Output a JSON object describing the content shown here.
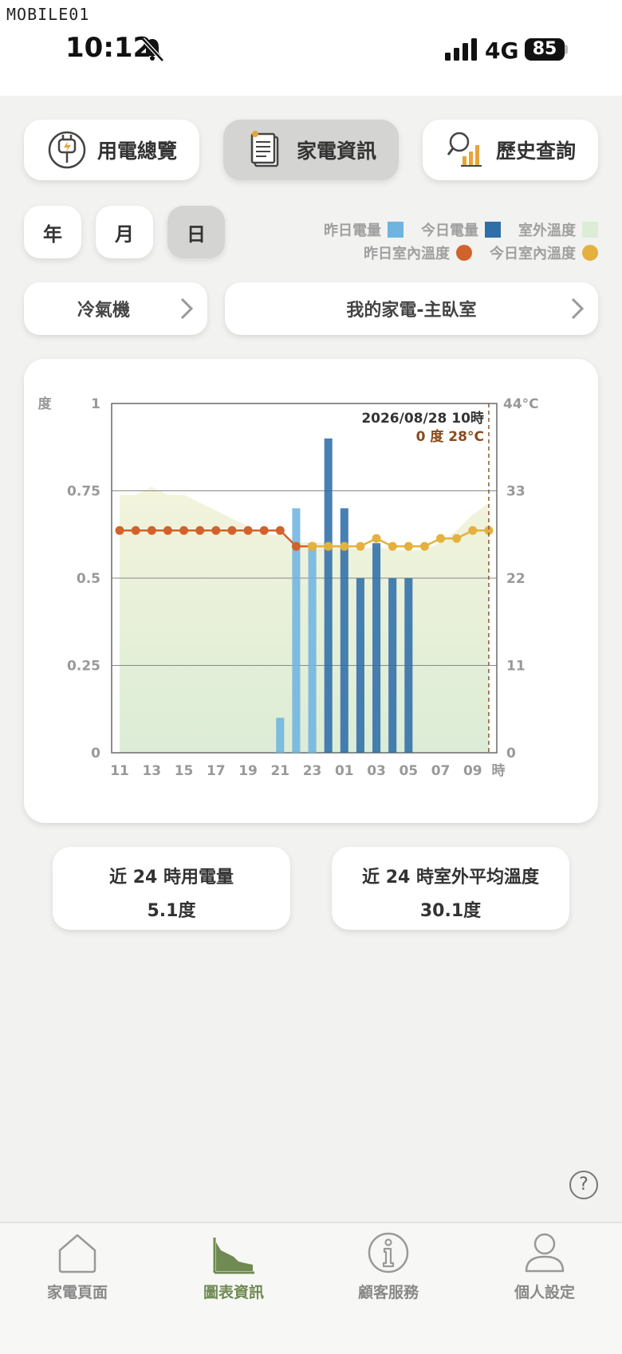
{
  "status_bar": {
    "watermark": "MOBILE01",
    "time": "10:12",
    "network": "4G",
    "battery": "85"
  },
  "top_tabs": [
    {
      "label": "用電總覽",
      "icon": "power-plug-icon",
      "active": false
    },
    {
      "label": "家電資訊",
      "icon": "document-icon",
      "active": true
    },
    {
      "label": "歷史查詢",
      "icon": "history-search-icon",
      "active": false
    }
  ],
  "period_buttons": [
    {
      "label": "年",
      "active": false
    },
    {
      "label": "月",
      "active": false
    },
    {
      "label": "日",
      "active": true
    }
  ],
  "legend": {
    "yesterday_power": "昨日電量",
    "today_power": "今日電量",
    "outdoor_temp": "室外溫度",
    "yesterday_indoor": "昨日室內溫度",
    "today_indoor": "今日室內溫度"
  },
  "selectors": {
    "appliance_type": "冷氣機",
    "appliance": "我的家電-主臥室"
  },
  "colors": {
    "yesterday_power": "#6fb4e0",
    "today_power": "#2f6ea8",
    "outdoor_temp": "#dcecd6",
    "yesterday_indoor": "#d2622c",
    "today_indoor": "#e4b13e",
    "accent": "#6f8a52"
  },
  "chart_data": {
    "type": "bar",
    "left_axis_unit": "度",
    "right_axis_unit": "44°C",
    "xunit": "時",
    "ylim": [
      0,
      1
    ],
    "y2lim": [
      0,
      44
    ],
    "yticks": [
      "0",
      "0.25",
      "0.5",
      "0.75",
      "1"
    ],
    "y2ticks": [
      "0",
      "11",
      "22",
      "33"
    ],
    "x_tick_labels": [
      "11",
      "13",
      "15",
      "17",
      "19",
      "21",
      "23",
      "01",
      "03",
      "05",
      "07",
      "09"
    ],
    "hours": [
      "11",
      "12",
      "13",
      "14",
      "15",
      "16",
      "17",
      "18",
      "19",
      "20",
      "21",
      "22",
      "23",
      "00",
      "01",
      "02",
      "03",
      "04",
      "05",
      "06",
      "07",
      "08",
      "09",
      "10"
    ],
    "series": [
      {
        "name": "昨日電量",
        "values": [
          0,
          0,
          0,
          0,
          0,
          0,
          0,
          0,
          0,
          0,
          0.1,
          0.7,
          0.6,
          0,
          0,
          0,
          0,
          0,
          0,
          0,
          0,
          0,
          0,
          0
        ]
      },
      {
        "name": "今日電量",
        "values": [
          0,
          0,
          0,
          0,
          0,
          0,
          0,
          0,
          0,
          0,
          0,
          0,
          0,
          0.9,
          0.7,
          0.5,
          0.6,
          0.5,
          0.5,
          0,
          0,
          0,
          0,
          0
        ]
      },
      {
        "name": "室外溫度",
        "values": [
          32.5,
          32.5,
          33.5,
          32.5,
          32.5,
          31.5,
          30.5,
          29.5,
          28.5,
          27.5,
          27.5,
          26.5,
          26.5,
          26.5,
          26,
          25.5,
          26,
          25.5,
          25.5,
          25.5,
          26.5,
          28,
          30,
          31.5
        ]
      },
      {
        "name": "昨日室內溫度",
        "values": [
          28,
          28,
          28,
          28,
          28,
          28,
          28,
          28,
          28,
          28,
          28,
          26,
          26,
          null,
          null,
          null,
          null,
          null,
          null,
          null,
          null,
          null,
          null,
          null
        ]
      },
      {
        "name": "今日室內溫度",
        "values": [
          null,
          null,
          null,
          null,
          null,
          null,
          null,
          null,
          null,
          null,
          null,
          null,
          26,
          26,
          26,
          26,
          27,
          26,
          26,
          26,
          27,
          27,
          28,
          28
        ]
      }
    ],
    "tooltip": {
      "title": "2026/08/28 10時",
      "value": "0 度 28°C"
    }
  },
  "stats": [
    {
      "label": "近 24 時用電量",
      "value": "5.1度"
    },
    {
      "label": "近 24 時室外平均溫度",
      "value": "30.1度"
    }
  ],
  "help": "?",
  "bottom_nav": [
    {
      "label": "家電頁面",
      "icon": "home-icon",
      "active": false
    },
    {
      "label": "圖表資訊",
      "icon": "chart-icon",
      "active": true
    },
    {
      "label": "顧客服務",
      "icon": "info-icon",
      "active": false
    },
    {
      "label": "個人設定",
      "icon": "person-icon",
      "active": false
    }
  ]
}
